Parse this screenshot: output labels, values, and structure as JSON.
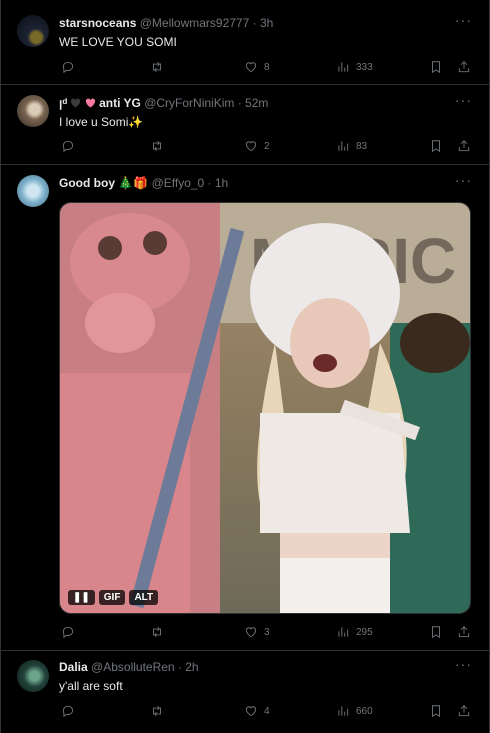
{
  "tweets": [
    {
      "name": "starsnoceans",
      "handle_time": "@Mellowmars92777 · 3h",
      "text": "WE LOVE YOU SOMI",
      "likes": "8",
      "views": "333"
    },
    {
      "name_prefix": "ꞁᵈ",
      "name_suffix": "anti YG",
      "handle_time": "@CryForNiniKim · 52m",
      "text": "I love u Somi✨",
      "likes": "2",
      "views": "83"
    },
    {
      "name": "Good boy 🎄🎁",
      "handle_time": "@Effyo_0 · 1h",
      "media": {
        "badge_pause": "❚❚",
        "badge_gif": "GIF",
        "badge_alt": "ALT"
      },
      "likes": "3",
      "views": "295"
    },
    {
      "name": "Dalia",
      "handle_time": "@AbsolluteRen · 2h",
      "text": "y'all are soft",
      "likes": "4",
      "views": "660"
    }
  ],
  "colors": {
    "background": "#000000",
    "divider": "#2f3336",
    "muted": "#71767b",
    "text": "#e7e9ea"
  },
  "icons": [
    "reply-icon",
    "retweet-icon",
    "like-icon",
    "views-icon",
    "bookmark-icon",
    "share-icon",
    "more-icon"
  ]
}
